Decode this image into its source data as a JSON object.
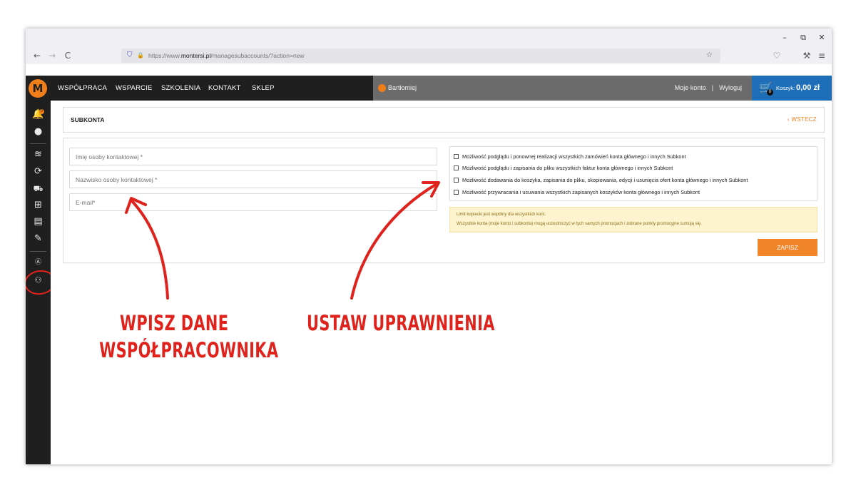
{
  "browser": {
    "url_prefix": "https://www.",
    "url_domain": "montersi.pl",
    "url_path": "/managesubaccounts/?action=new",
    "minimize": "–",
    "restore": "⧉",
    "close": "✕",
    "back": "←",
    "forward": "→",
    "reload": "C",
    "shield": "⛉",
    "lock": "🔒",
    "star": "☆",
    "pocket": "♡",
    "tools": "⚒",
    "menu": "≡"
  },
  "header": {
    "logo": "M",
    "menu": [
      "WSPÓŁPRACA",
      "WSPARCIE",
      "SZKOLENIA",
      "KONTAKT",
      "SKLEP"
    ],
    "user_name": "Bartłomiej",
    "account_link": "Moje konto",
    "separator": "|",
    "logout_link": "Wyloguj",
    "cart_label": "Koszyk:",
    "cart_value": "0,00 zł",
    "cart_count": "0"
  },
  "sidebar": {
    "notification_count": "0",
    "icons": [
      "bell-icon",
      "user-icon",
      "layers-icon",
      "refresh-icon",
      "cart-icon",
      "grid-icon",
      "document-icon",
      "pencil-icon",
      "text-box-icon",
      "subaccounts-icon"
    ]
  },
  "panel": {
    "title": "SUBKONTA",
    "back_label": "WSTECZ",
    "fields": {
      "first_name_placeholder": "Imię osoby kontaktowej *",
      "last_name_placeholder": "Nazwisko osoby kontaktowej *",
      "email_placeholder": "E-mail*"
    },
    "permissions": [
      "Możliwość podglądu i ponownej realizacji wszystkich zamówień konta głównego i innych Subkont",
      "Możliwość podglądu i zapisania do pliku wszystkich faktur konta głównego i innych Subkont",
      "Możliwość dodawania do koszyka, zapisania do pliku, skopiowania, edycji i usunięcia ofert konta głównego i innych Subkont",
      "Możliwość przywracania i usuwania wszystkich zapisanych koszyków konta głównego i innych Subkont"
    ],
    "notice_line1": "Limit kupiecki jest wspólny dla wszystkich kont.",
    "notice_line2": "Wszystkie konta (moje konto i subkonta) mogą uczestniczyć w tych samych promocjach i zebrane punkty promocyjne sumują się.",
    "save_label": "ZAPISZ"
  },
  "annotations": {
    "left_line1": "WPISZ DANE",
    "left_line2": "WSPÓŁPRACOWNIKA",
    "right": "USTAW UPRAWNIENIA",
    "color": "#e0221c"
  },
  "colors": {
    "accent": "#f07f1a",
    "header_dark": "#1f1f1f",
    "cart_blue": "#1e6fb8"
  }
}
